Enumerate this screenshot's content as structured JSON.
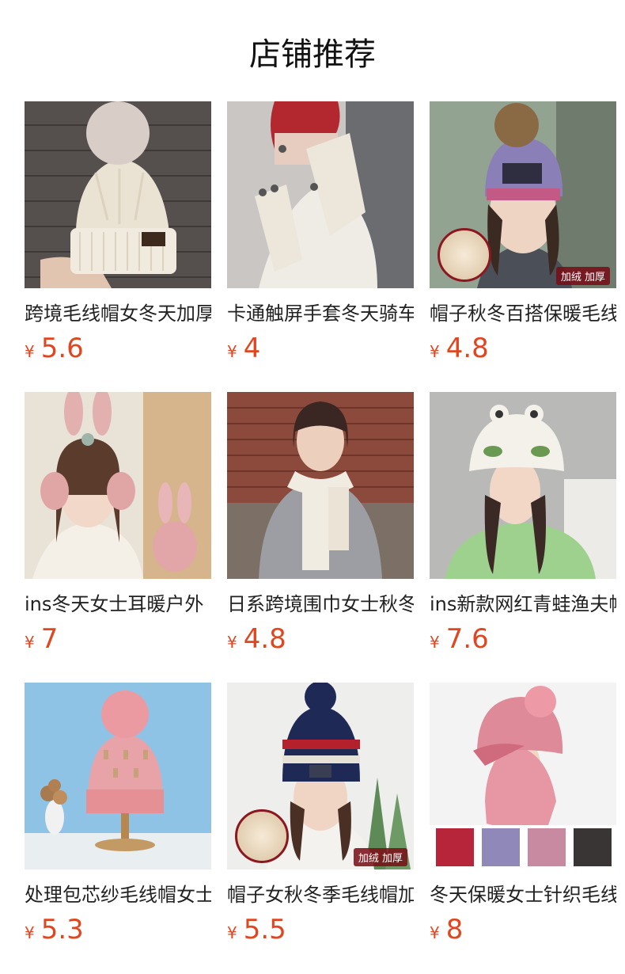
{
  "header": {
    "title": "店铺推荐"
  },
  "currency": "¥",
  "products": [
    {
      "name": "跨境毛线帽女冬天加厚",
      "price": "5.6",
      "image": "cream-knit-pompom-beanie"
    },
    {
      "name": "卡通触屏手套冬天骑车",
      "price": "4",
      "image": "cream-touchscreen-gloves"
    },
    {
      "name": "帽子秋冬百搭保暖毛线帽",
      "price": "4.8",
      "image": "multicolor-beanie-woman",
      "badge": "加绒 加厚"
    },
    {
      "name": "ins冬天女士耳暖户外",
      "price": "7",
      "image": "pink-bunny-earmuffs"
    },
    {
      "name": "日系跨境围巾女士秋冬",
      "price": "4.8",
      "image": "cream-knit-scarf"
    },
    {
      "name": "ins新款网红青蛙渔夫帽",
      "price": "7.6",
      "image": "frog-bucket-hat"
    },
    {
      "name": "处理包芯纱毛线帽女士",
      "price": "5.3",
      "image": "pink-beanie-on-stand"
    },
    {
      "name": "帽子女秋冬季毛线帽加绒",
      "price": "5.5",
      "image": "navy-pompom-beanie",
      "badge": "加绒 加厚"
    },
    {
      "name": "冬天保暖女士针织毛线帽",
      "price": "8",
      "image": "pink-balaclava-hat"
    }
  ],
  "colors": {
    "price": "#e0461f"
  }
}
